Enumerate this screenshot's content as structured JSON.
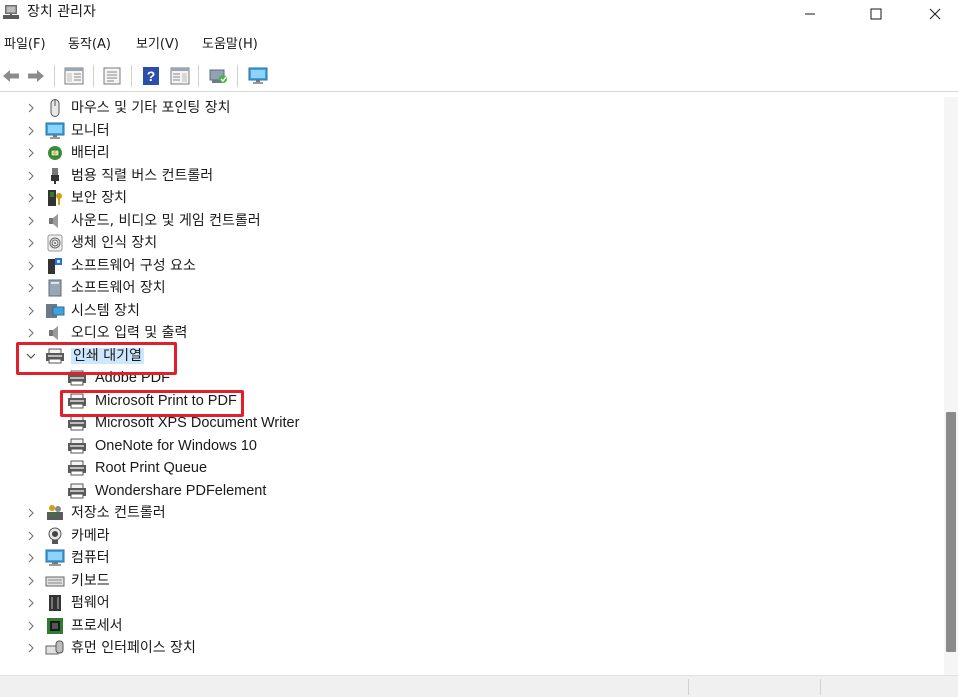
{
  "window": {
    "title": "장치 관리자",
    "controls": {
      "minimize": "minimize",
      "maximize": "maximize",
      "close": "close"
    }
  },
  "menu": [
    {
      "label": "파일(F)"
    },
    {
      "label": "동작(A)"
    },
    {
      "label": "보기(V)"
    },
    {
      "label": "도움말(H)"
    }
  ],
  "toolbar": {
    "icons": [
      "back-arrow-icon",
      "forward-arrow-icon",
      "properties-pane-icon",
      "list-view-icon",
      "help-icon",
      "action-pane-icon",
      "scan-hardware-icon",
      "monitor-icon"
    ]
  },
  "tree": {
    "nodes": [
      {
        "label": "마우스 및 기타 포인팅 장치",
        "icon": "mouse-icon",
        "expanded": false
      },
      {
        "label": "모니터",
        "icon": "monitor-icon",
        "expanded": false
      },
      {
        "label": "배터리",
        "icon": "battery-icon",
        "expanded": false
      },
      {
        "label": "범용 직렬 버스 컨트롤러",
        "icon": "usb-icon",
        "expanded": false
      },
      {
        "label": "보안 장치",
        "icon": "security-key-icon",
        "expanded": false
      },
      {
        "label": "사운드, 비디오 및 게임 컨트롤러",
        "icon": "speaker-icon",
        "expanded": false
      },
      {
        "label": "생체 인식 장치",
        "icon": "fingerprint-icon",
        "expanded": false
      },
      {
        "label": "소프트웨어 구성 요소",
        "icon": "software-component-icon",
        "expanded": false
      },
      {
        "label": "소프트웨어 장치",
        "icon": "software-device-icon",
        "expanded": false
      },
      {
        "label": "시스템 장치",
        "icon": "system-device-icon",
        "expanded": false
      },
      {
        "label": "오디오 입력 및 출력",
        "icon": "speaker-icon",
        "expanded": false
      },
      {
        "label": "인쇄 대기열",
        "icon": "printer-icon",
        "expanded": true,
        "selected": true
      },
      {
        "label": "Adobe PDF",
        "icon": "printer-icon",
        "child": true
      },
      {
        "label": "Microsoft Print to PDF",
        "icon": "printer-icon",
        "child": true,
        "highlighted": true
      },
      {
        "label": "Microsoft XPS Document Writer",
        "icon": "printer-icon",
        "child": true
      },
      {
        "label": "OneNote for Windows 10",
        "icon": "printer-icon",
        "child": true
      },
      {
        "label": "Root Print Queue",
        "icon": "printer-icon",
        "child": true
      },
      {
        "label": "Wondershare PDFelement",
        "icon": "printer-icon",
        "child": true
      },
      {
        "label": "저장소 컨트롤러",
        "icon": "storage-controller-icon",
        "expanded": false
      },
      {
        "label": "카메라",
        "icon": "camera-icon",
        "expanded": false
      },
      {
        "label": "컴퓨터",
        "icon": "computer-icon",
        "expanded": false
      },
      {
        "label": "키보드",
        "icon": "keyboard-icon",
        "expanded": false
      },
      {
        "label": "펌웨어",
        "icon": "firmware-icon",
        "expanded": false
      },
      {
        "label": "프로세서",
        "icon": "processor-icon",
        "expanded": false
      },
      {
        "label": "휴먼 인터페이스 장치",
        "icon": "hid-icon",
        "expanded": false
      }
    ]
  },
  "colors": {
    "highlight": "#e0202a",
    "selection": "#cce8ff"
  }
}
